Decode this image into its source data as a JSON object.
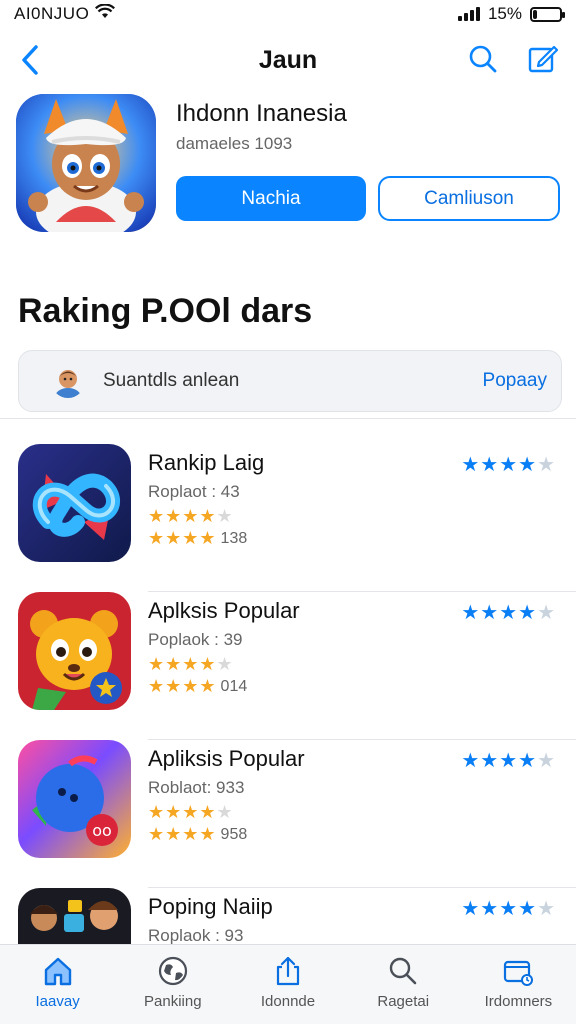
{
  "status_bar": {
    "carrier": "AI0NJUO",
    "battery_text": "15%",
    "battery_level": 0.15
  },
  "nav": {
    "title": "Jaun"
  },
  "header": {
    "app_name": "Ihdonn Inanesia",
    "meta": "damaeles 1093",
    "primary_button": "Nachia",
    "secondary_button": "Camliuson"
  },
  "section": {
    "title": "Raking P.OOl dars",
    "filter_text": "Suantdls anlean",
    "filter_action": "Popaay"
  },
  "list": [
    {
      "title": "Rankip Laig",
      "subtitle": "Roplaot : 43",
      "rating_count": "138",
      "stars": 4,
      "icon": "infinity-app-icon"
    },
    {
      "title": "Aplksis Popular",
      "subtitle": "Poplaok : 39",
      "rating_count": "014",
      "stars": 4,
      "icon": "bear-app-icon"
    },
    {
      "title": "Apliksis Popular",
      "subtitle": "Roblaot: 933",
      "rating_count": "958",
      "stars": 4,
      "icon": "blob-app-icon"
    },
    {
      "title": "Poping Naiip",
      "subtitle": "Roplaok : 93",
      "rating_count": "",
      "stars": 4,
      "icon": "characters-app-icon"
    }
  ],
  "tabs": [
    {
      "label": "Iaavay",
      "icon": "home-icon",
      "active": true
    },
    {
      "label": "Pankiing",
      "icon": "globe-icon",
      "active": false
    },
    {
      "label": "Idonnde",
      "icon": "share-icon",
      "active": false
    },
    {
      "label": "Ragetai",
      "icon": "search-icon",
      "active": false
    },
    {
      "label": "Irdomners",
      "icon": "wallet-icon",
      "active": false
    }
  ],
  "colors": {
    "accent": "#0a84ff",
    "star_gold": "#f5a623",
    "star_blue": "#0a7ef5"
  }
}
